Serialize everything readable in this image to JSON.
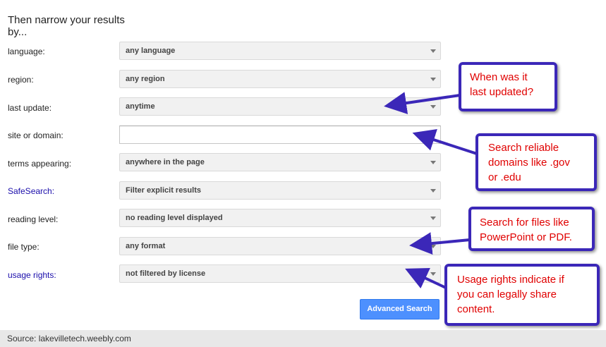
{
  "heading": "Then narrow your results\nby...",
  "rows": [
    {
      "label": "language:",
      "value": "any language",
      "link": false,
      "kind": "select"
    },
    {
      "label": "region:",
      "value": "any region",
      "link": false,
      "kind": "select"
    },
    {
      "label": "last update:",
      "value": "anytime",
      "link": false,
      "kind": "select"
    },
    {
      "label": "site or domain:",
      "value": "",
      "link": false,
      "kind": "input"
    },
    {
      "label": "terms appearing:",
      "value": "anywhere in the page",
      "link": false,
      "kind": "select"
    },
    {
      "label": "SafeSearch:",
      "value": "Filter explicit results",
      "link": true,
      "kind": "select"
    },
    {
      "label": "reading level:",
      "value": "no reading level displayed",
      "link": false,
      "kind": "select"
    },
    {
      "label": "file type:",
      "value": "any format",
      "link": false,
      "kind": "select"
    },
    {
      "label": "usage rights:",
      "value": "not filtered by license",
      "link": true,
      "kind": "select"
    }
  ],
  "button": "Advanced Search",
  "footer": "Source: lakevilletech.weebly.com",
  "callouts": [
    "When was it\nlast updated?",
    "Search reliable\ndomains like .gov\nor .edu",
    "Search for files like\nPowerPoint or PDF.",
    "Usage rights indicate if\nyou can legally share\ncontent."
  ],
  "colors": {
    "callout_border": "#3b27b8",
    "callout_text": "#e00000",
    "link": "#1a0dab",
    "button": "#4d90fe"
  }
}
